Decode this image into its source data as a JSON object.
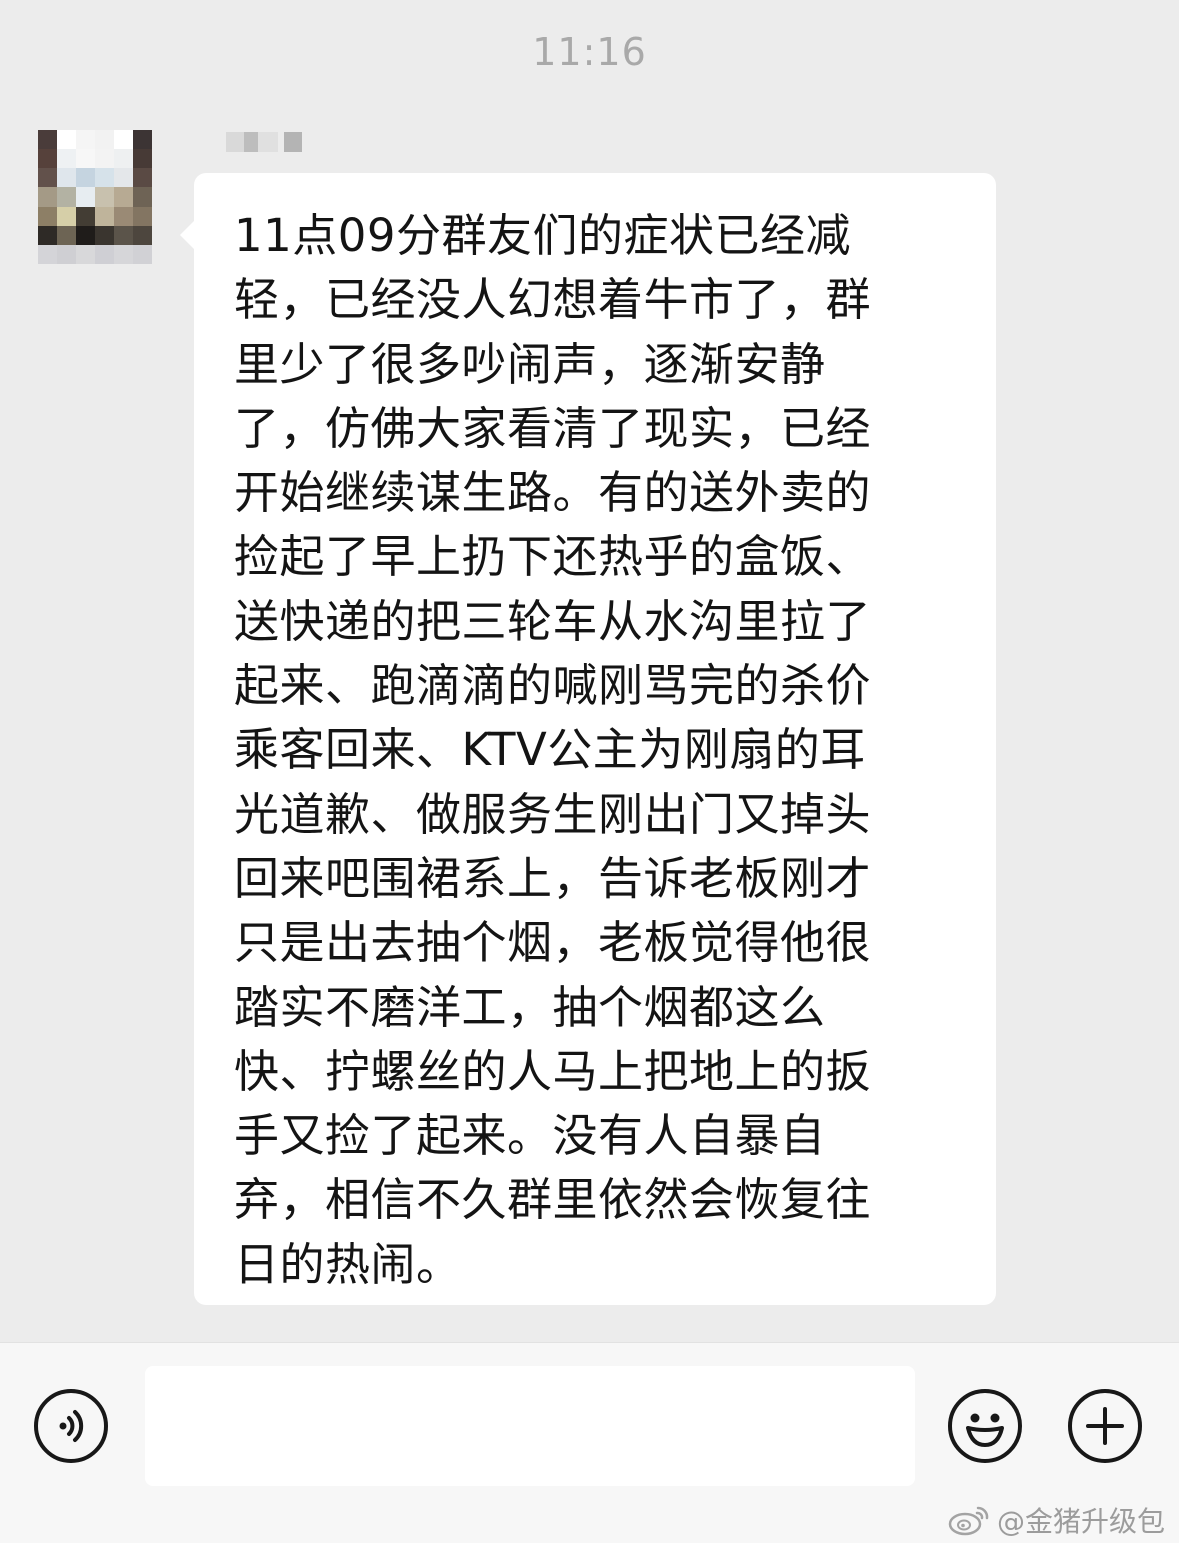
{
  "header": {
    "timestamp": "11:16"
  },
  "chat": {
    "sender": {
      "avatar_icon": "pixelated-avatar-icon"
    },
    "message": {
      "text": "11点09分群友们的症状已经减\n轻，已经没人幻想着牛市了，群\n里少了很多吵闹声，逐渐安静\n了，仿佛大家看清了现实，已经\n开始继续谋生路。有的送外卖的\n捡起了早上扔下还热乎的盒饭、\n送快递的把三轮车从水沟里拉了\n起来、跑滴滴的喊刚骂完的杀价\n乘客回来、KTV公主为刚扇的耳\n光道歉、做服务生刚出门又掉头\n回来吧围裙系上，告诉老板刚才\n只是出去抽个烟，老板觉得他很\n踏实不磨洋工，抽个烟都这么\n快、拧螺丝的人马上把地上的扳\n手又捡了起来。没有人自暴自\n弃，相信不久群里依然会恢复往\n日的热闹。"
    }
  },
  "input_bar": {
    "voice_icon": "voice-icon",
    "message_input_value": "",
    "emoji_icon": "smiley-face-icon",
    "plus_icon": "plus-icon"
  },
  "watermark": {
    "icon": "weibo-logo-icon",
    "text": "@金猪升级包"
  },
  "colors": {
    "background": "#ececec",
    "bubble": "#ffffff",
    "text": "#141414",
    "timestamp": "#a9a9a9",
    "input_bar": "#f7f7f7",
    "icon_stroke": "#181818",
    "watermark": "#9c9c9c"
  }
}
